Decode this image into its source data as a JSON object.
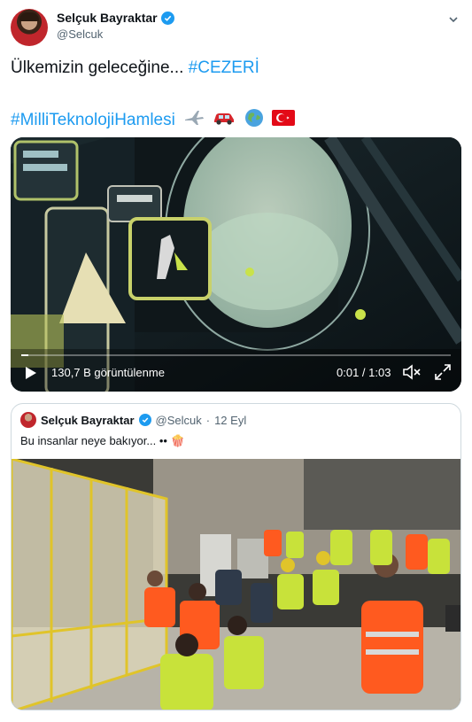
{
  "author": {
    "name": "Selçuk Bayraktar",
    "handle": "@Selcuk"
  },
  "tweet": {
    "line1_text": "Ülkemizin geleceğine... ",
    "line1_tag": "#CEZERİ",
    "line2_tag": "#MilliTeknolojiHamlesi"
  },
  "video": {
    "views": "130,7 B görüntülenme",
    "time": "0:01 / 1:03",
    "progress": 0.016
  },
  "quote": {
    "name": "Selçuk Bayraktar",
    "handle": "@Selcuk",
    "dot": "·",
    "date": "12 Eyl",
    "text": "Bu insanlar neye bakıyor... •• 🍿"
  },
  "colors": {
    "accent": "#1d9bf0",
    "vest": "#ff5a1f",
    "hi_vis": "#c8e23a"
  },
  "icons": [
    "verified-badge-icon",
    "chevron-down-icon",
    "airplane-emoji",
    "car-emoji",
    "globe-emoji",
    "turkey-flag-emoji",
    "play-icon",
    "mute-icon",
    "fullscreen-icon"
  ]
}
